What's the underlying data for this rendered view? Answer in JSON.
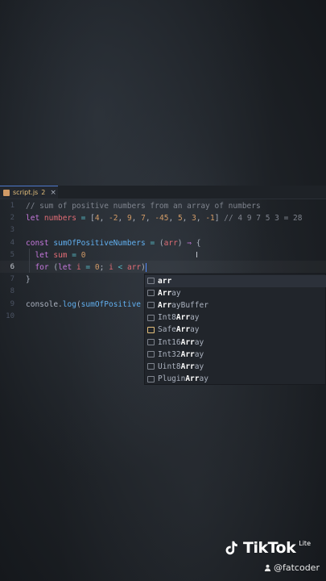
{
  "tab": {
    "filename": "script.js",
    "badge": "2",
    "close": "×"
  },
  "lines": [
    {
      "num": "1",
      "tokens": [
        {
          "c": "cm",
          "t": "// sum of positive numbers from an array of numbers"
        }
      ]
    },
    {
      "num": "2",
      "tokens": [
        {
          "c": "kw",
          "t": "let "
        },
        {
          "c": "var",
          "t": "numbers"
        },
        {
          "c": "op",
          "t": " = "
        },
        {
          "c": "pl",
          "t": "["
        },
        {
          "c": "num",
          "t": "4"
        },
        {
          "c": "pl",
          "t": ", "
        },
        {
          "c": "num",
          "t": "-2"
        },
        {
          "c": "pl",
          "t": ", "
        },
        {
          "c": "num",
          "t": "9"
        },
        {
          "c": "pl",
          "t": ", "
        },
        {
          "c": "num",
          "t": "7"
        },
        {
          "c": "pl",
          "t": ", "
        },
        {
          "c": "num",
          "t": "-45"
        },
        {
          "c": "pl",
          "t": ", "
        },
        {
          "c": "num",
          "t": "5"
        },
        {
          "c": "pl",
          "t": ", "
        },
        {
          "c": "num",
          "t": "3"
        },
        {
          "c": "pl",
          "t": ", "
        },
        {
          "c": "num",
          "t": "-1"
        },
        {
          "c": "pl",
          "t": "] "
        },
        {
          "c": "cm",
          "t": "// 4 9 7 5 3 = 28"
        }
      ]
    },
    {
      "num": "3",
      "tokens": []
    },
    {
      "num": "4",
      "tokens": [
        {
          "c": "kw",
          "t": "const "
        },
        {
          "c": "fn",
          "t": "sumOfPositiveNumbers"
        },
        {
          "c": "op",
          "t": " = "
        },
        {
          "c": "pl",
          "t": "("
        },
        {
          "c": "var",
          "t": "arr"
        },
        {
          "c": "pl",
          "t": ") "
        },
        {
          "c": "kw",
          "t": "⇒"
        },
        {
          "c": "pl",
          "t": " {"
        }
      ]
    },
    {
      "num": "5",
      "tokens": [
        {
          "c": "pl",
          "t": "  "
        },
        {
          "c": "kw",
          "t": "let "
        },
        {
          "c": "var",
          "t": "sum"
        },
        {
          "c": "op",
          "t": " = "
        },
        {
          "c": "num",
          "t": "0"
        }
      ]
    },
    {
      "num": "6",
      "tokens": [
        {
          "c": "pl",
          "t": "  "
        },
        {
          "c": "kw",
          "t": "for "
        },
        {
          "c": "pl",
          "t": "("
        },
        {
          "c": "kw",
          "t": "let "
        },
        {
          "c": "var",
          "t": "i"
        },
        {
          "c": "op",
          "t": " = "
        },
        {
          "c": "num",
          "t": "0"
        },
        {
          "c": "pl",
          "t": "; "
        },
        {
          "c": "var",
          "t": "i"
        },
        {
          "c": "op",
          "t": " < "
        },
        {
          "c": "var",
          "t": "arr"
        },
        {
          "c": "pl",
          "t": ")"
        }
      ]
    },
    {
      "num": "7",
      "tokens": [
        {
          "c": "pl",
          "t": "}"
        }
      ]
    },
    {
      "num": "8",
      "tokens": []
    },
    {
      "num": "9",
      "tokens": [
        {
          "c": "pl",
          "t": "console."
        },
        {
          "c": "fn",
          "t": "log"
        },
        {
          "c": "pl",
          "t": "("
        },
        {
          "c": "fn",
          "t": "sumOfPositive"
        }
      ]
    },
    {
      "num": "10",
      "tokens": []
    }
  ],
  "active_line": "6",
  "suggestions": [
    {
      "icon": "[⊡]",
      "kind": "var",
      "match": "arr",
      "rest": ""
    },
    {
      "icon": "[⊡]",
      "kind": "var",
      "match": "Ar",
      "mid": "r",
      "rest": "ay"
    },
    {
      "icon": "[⊡]",
      "kind": "var",
      "match": "Ar",
      "mid": "r",
      "rest": "ayBuffer"
    },
    {
      "icon": "[⊡]",
      "kind": "var",
      "pre": "Int8",
      "match": "Arr",
      "rest": "ay"
    },
    {
      "icon": "⊕",
      "kind": "class",
      "pre": "Safe",
      "match": "Arr",
      "rest": "ay"
    },
    {
      "icon": "[⊡]",
      "kind": "var",
      "pre": "Int16",
      "match": "Arr",
      "rest": "ay"
    },
    {
      "icon": "[⊡]",
      "kind": "var",
      "pre": "Int32",
      "match": "Arr",
      "rest": "ay"
    },
    {
      "icon": "[⊡]",
      "kind": "var",
      "pre": "Uint8",
      "match": "Arr",
      "rest": "ay"
    },
    {
      "icon": "[⊡]",
      "kind": "var",
      "pre": "Plugin",
      "match": "Arr",
      "rest": "ay"
    }
  ],
  "watermark": {
    "brand": "TikTok",
    "lite": "Lite",
    "handle": "@fatcoder"
  }
}
